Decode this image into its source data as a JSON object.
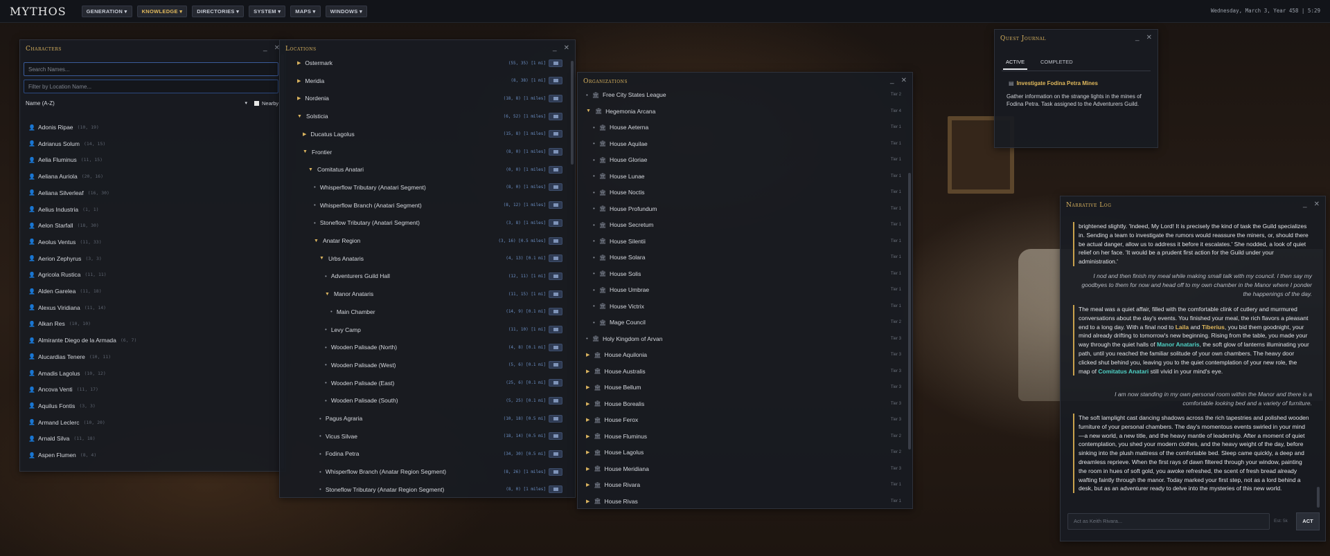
{
  "app": {
    "logo": "MYTHOS",
    "date": "Wednesday, March 3, Year 458 | 5:29"
  },
  "menus": [
    "GENERATION ▾",
    "KNOWLEDGE ▾",
    "DIRECTORIES ▾",
    "SYSTEM ▾",
    "MAPS ▾",
    "WINDOWS ▾"
  ],
  "characters": {
    "title": "Characters",
    "search_placeholder": "Search Names...",
    "filter_placeholder": "Filter by Location Name...",
    "sort": "Name (A-Z)",
    "nearby": "Nearby",
    "items": [
      [
        "Adonis Ripae",
        "(10, 19)"
      ],
      [
        "Adrianus Solum",
        "(14, 15)"
      ],
      [
        "Aelia Fluminus",
        "(11, 15)"
      ],
      [
        "Aeliana Auriola",
        "(20, 16)"
      ],
      [
        "Aeliana Silverleaf",
        "(16, 30)"
      ],
      [
        "Aelius Industria",
        "(1, 1)"
      ],
      [
        "Aelon Starfall",
        "(18, 30)"
      ],
      [
        "Aeolus Ventus",
        "(11, 33)"
      ],
      [
        "Aerion Zephyrus",
        "(3, 3)"
      ],
      [
        "Agricola Rustica",
        "(11, 11)"
      ],
      [
        "Alden Garelea",
        "(11, 18)"
      ],
      [
        "Alexus Viridiana",
        "(11, 14)"
      ],
      [
        "Alkan Res",
        "(10, 10)"
      ],
      [
        "Almirante Diego de la Armada",
        "(6, 7)"
      ],
      [
        "Alucardias Tenere",
        "(10, 11)"
      ],
      [
        "Amadis Lagolus",
        "(10, 12)"
      ],
      [
        "Ancova Venti",
        "(11, 17)"
      ],
      [
        "Aquilus Fontis",
        "(3, 3)"
      ],
      [
        "Armand Leclerc",
        "(10, 20)"
      ],
      [
        "Arnald Silva",
        "(11, 18)"
      ],
      [
        "Aspen Flumen",
        "(8, 4)"
      ]
    ]
  },
  "locations": {
    "title": "Locations",
    "items": [
      [
        "Ostermark",
        "(55, 35)",
        "[1 mi]",
        "tri",
        1
      ],
      [
        "Meridia",
        "(8, 38)",
        "[1 mi]",
        "tri",
        1
      ],
      [
        "Nordenia",
        "(18, 8)",
        "[1 miles]",
        "tri",
        1
      ],
      [
        "Solsticia",
        "(6, 52)",
        "[1 miles]",
        "open",
        1
      ],
      [
        "Ducatus Lagolus",
        "(15, 8)",
        "[1 miles]",
        "tri",
        2
      ],
      [
        "Frontier",
        "(8, 0)",
        "[1 miles]",
        "open",
        2
      ],
      [
        "Comitatus Anatari",
        "(0, 0)",
        "[1 miles]",
        "open",
        3
      ],
      [
        "Whisperflow Tributary (Anatari Segment)",
        "(8, 0)",
        "[1 miles]",
        "dot",
        4
      ],
      [
        "Whisperflow Branch (Anatari Segment)",
        "(8, 12)",
        "[1 miles]",
        "dot",
        4
      ],
      [
        "Stoneflow Tributary (Anatari Segment)",
        "(3, 8)",
        "[1 miles]",
        "dot",
        4
      ],
      [
        "Anatar Region",
        "(3, 16)",
        "[0.5 miles]",
        "open",
        4
      ],
      [
        "Urbs Anataris",
        "(4, 13)",
        "[0.1 mi]",
        "open",
        5
      ],
      [
        "Adventurers Guild Hall",
        "(12, 11)",
        "[1 mi]",
        "dot",
        6
      ],
      [
        "Manor Anataris",
        "(11, 15)",
        "[1 mi]",
        "open",
        6
      ],
      [
        "Main Chamber",
        "(14, 9)",
        "[0.1 mi]",
        "dot",
        7
      ],
      [
        "Levy Camp",
        "(11, 10)",
        "[1 mi]",
        "dot",
        6
      ],
      [
        "Wooden Palisade (North)",
        "(4, 8)",
        "[0.1 mi]",
        "dot",
        6
      ],
      [
        "Wooden Palisade (West)",
        "(5, 6)",
        "[0.1 mi]",
        "dot",
        6
      ],
      [
        "Wooden Palisade (East)",
        "(25, 6)",
        "[0.1 mi]",
        "dot",
        6
      ],
      [
        "Wooden Palisade (South)",
        "(5, 25)",
        "[0.1 mi]",
        "dot",
        6
      ],
      [
        "Pagus Agraria",
        "(10, 18)",
        "[0.5 mi]",
        "dot",
        5
      ],
      [
        "Vicus Silvae",
        "(18, 14)",
        "[0.5 mi]",
        "dot",
        5
      ],
      [
        "Fodina Petra",
        "(34, 30)",
        "[0.5 mi]",
        "dot",
        5
      ],
      [
        "Whisperflow Branch (Anatar Region Segment)",
        "(8, 26)",
        "[1 miles]",
        "dot",
        5
      ],
      [
        "Stoneflow Tributary (Anatar Region Segment)",
        "(8, 0)",
        "[1 miles]",
        "dot",
        5
      ]
    ]
  },
  "organizations": {
    "title": "Organizations",
    "items": [
      [
        "Free City States League",
        "Tier 2",
        "dot",
        1
      ],
      [
        "Hegemonia Arcana",
        "Tier 4",
        "open",
        1
      ],
      [
        "House Aeterna",
        "Tier 1",
        "dot",
        2
      ],
      [
        "House Aquilae",
        "Tier 1",
        "dot",
        2
      ],
      [
        "House Gloriae",
        "Tier 1",
        "dot",
        2
      ],
      [
        "House Lunae",
        "Tier 1",
        "dot",
        2
      ],
      [
        "House Noctis",
        "Tier 1",
        "dot",
        2
      ],
      [
        "House Profundum",
        "Tier 1",
        "dot",
        2
      ],
      [
        "House Secretum",
        "Tier 1",
        "dot",
        2
      ],
      [
        "House Silentii",
        "Tier 1",
        "dot",
        2
      ],
      [
        "House Solara",
        "Tier 1",
        "dot",
        2
      ],
      [
        "House Solis",
        "Tier 1",
        "dot",
        2
      ],
      [
        "House Umbrae",
        "Tier 1",
        "dot",
        2
      ],
      [
        "House Victrix",
        "Tier 1",
        "dot",
        2
      ],
      [
        "Mage Council",
        "Tier 2",
        "dot",
        2
      ],
      [
        "Holy Kingdom of Arvan",
        "Tier 3",
        "dot",
        1
      ],
      [
        "House Aquilonia",
        "Tier 3",
        "tri",
        1
      ],
      [
        "House Australis",
        "Tier 3",
        "tri",
        1
      ],
      [
        "House Bellum",
        "Tier 3",
        "tri",
        1
      ],
      [
        "House Borealis",
        "Tier 3",
        "tri",
        1
      ],
      [
        "House Ferox",
        "Tier 3",
        "tri",
        1
      ],
      [
        "House Fluminus",
        "Tier 2",
        "tri",
        1
      ],
      [
        "House Lagolus",
        "Tier 2",
        "tri",
        1
      ],
      [
        "House Meridiana",
        "Tier 3",
        "tri",
        1
      ],
      [
        "House Rivara",
        "Tier 1",
        "tri",
        1
      ],
      [
        "House Rivas",
        "Tier 1",
        "tri",
        1
      ]
    ]
  },
  "quest": {
    "title": "Quest Journal",
    "tab_active": "ACTIVE",
    "tab_completed": "COMPLETED",
    "quest_title": "Investigate Fodina Petra Mines",
    "quest_desc": "Gather information on the strange lights in the mines of Fodina Petra. Task assigned to the Adventurers Guild."
  },
  "log": {
    "title": "Narrative Log",
    "p1": "brightened slightly. 'Indeed, My Lord! It is precisely the kind of task the Guild specializes in. Sending a team to investigate the rumors would reassure the miners, or, should there be actual danger, allow us to address it before it escalates.' She nodded, a look of quiet relief on her face. 'It would be a prudent first action for the Guild under your administration.'",
    "q1": "I nod and then finish my meal while making small talk with my council. I then say my goodbyes to them for now and head off to my own chamber in the Manor where I ponder the happenings of the day.",
    "p2a": "The meal was a quiet affair, filled with the comfortable clink of cutlery and murmured conversations about the day's events. You finished your meal, the rich flavors a pleasant end to a long day. With a final nod to ",
    "laila": "Laila",
    "and": " and ",
    "tiberius": "Tiberius",
    "p2b": ", you bid them goodnight, your mind already drifting to tomorrow's new beginning. Rising from the table, you made your way through the quiet halls of ",
    "manor": "Manor Anataris",
    "p2c": ", the soft glow of lanterns illuminating your path, until you reached the familiar solitude of your own chambers. The heavy door clicked shut behind you, leaving you to the quiet contemplation of your new role, the map of ",
    "comitatus": "Comitatus Anatari",
    "p2d": " still vivid in your mind's eye.",
    "q2": "I am now standing in my own personal room within the Manor and there is a comfortable looking bed and a variety of furniture.",
    "p3": "The soft lamplight cast dancing shadows across the rich tapestries and polished wooden furniture of your personal chambers. The day's momentous events swirled in your mind—a new world, a new title, and the heavy mantle of leadership. After a moment of quiet contemplation, you shed your modern clothes, and the heavy weight of the day, before sinking into the plush mattress of the comfortable bed. Sleep came quickly, a deep and dreamless reprieve. When the first rays of dawn filtered through your window, painting the room in hues of soft gold, you awoke refreshed, the scent of fresh bread already wafting faintly through the manor. Today marked your first step, not as a lord behind a desk, but as an adventurer ready to delve into the mysteries of this new world.",
    "act_placeholder": "Act as Keith Rivara...",
    "est": "Est: 5k",
    "act": "ACT"
  }
}
